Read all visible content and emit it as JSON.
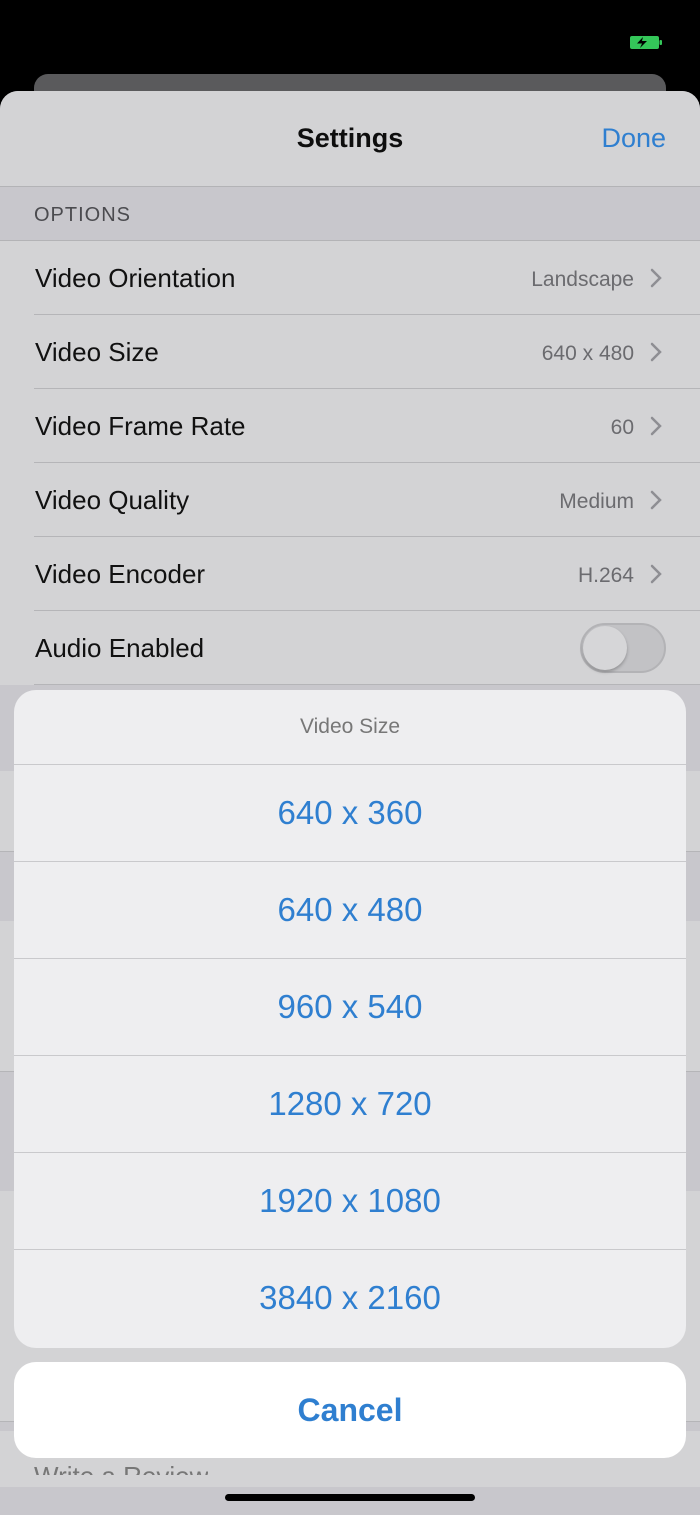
{
  "status_bar": {
    "battery_icon": "battery-charging-icon",
    "battery_color": "#34c759"
  },
  "navbar": {
    "title": "Settings",
    "done_label": "Done"
  },
  "options": {
    "header": "OPTIONS",
    "rows": [
      {
        "label": "Video Orientation",
        "value": "Landscape"
      },
      {
        "label": "Video Size",
        "value": "640 x 480"
      },
      {
        "label": "Video Frame Rate",
        "value": "60"
      },
      {
        "label": "Video Quality",
        "value": "Medium"
      },
      {
        "label": "Video Encoder",
        "value": "H.264"
      }
    ],
    "audio": {
      "label": "Audio Enabled",
      "enabled": false
    }
  },
  "action_sheet": {
    "title": "Video Size",
    "options": [
      "640 x 360",
      "640 x 480",
      "960 x 540",
      "1280 x 720",
      "1920 x 1080",
      "3840 x 2160"
    ],
    "cancel_label": "Cancel"
  },
  "behind": {
    "peek_label": "Write a Review"
  },
  "accent_color": "#2f7fd0"
}
